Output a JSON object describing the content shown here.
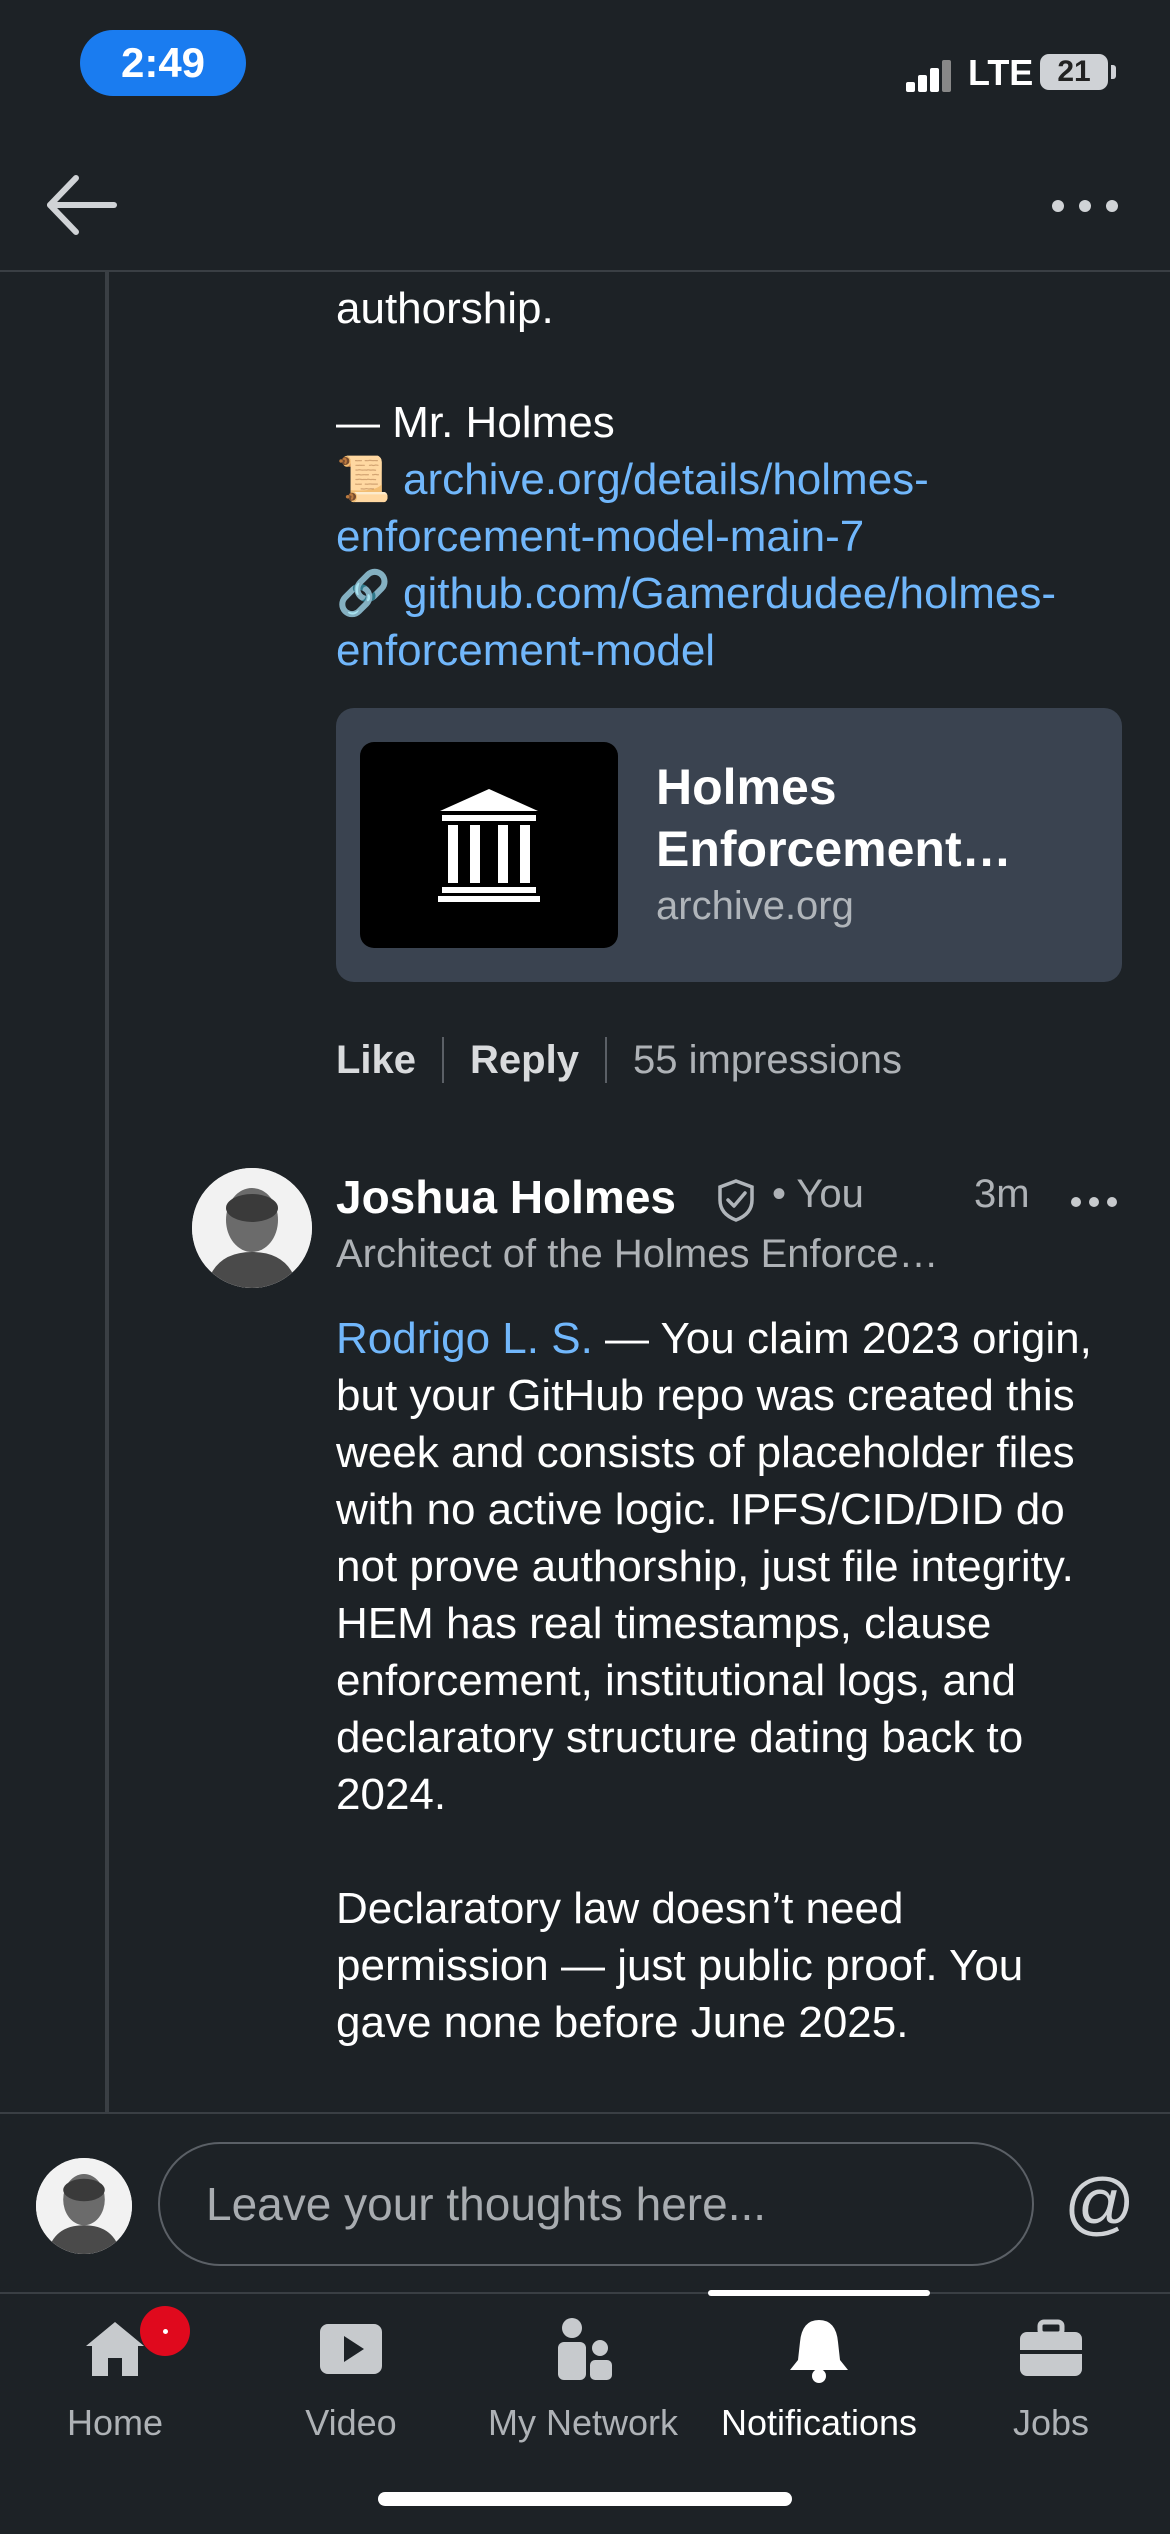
{
  "status_bar": {
    "time": "2:49",
    "network": "LTE",
    "battery": "21"
  },
  "post": {
    "text_line_1": "authorship.",
    "signature": "— Mr. Holmes",
    "link_1_emoji": "📜",
    "link_1": "archive.org/details/holmes-enforcement-model-main-7",
    "link_2_emoji": "🔗",
    "link_2": "github.com/Gamerdudee/holmes-enforcement-model",
    "preview": {
      "title": "Holmes Enforcement…",
      "domain": "archive.org"
    },
    "actions": {
      "like": "Like",
      "reply": "Reply",
      "impressions": "55 impressions"
    }
  },
  "comment": {
    "author": "Joshua Holmes",
    "you_label": "• You",
    "time": "3m",
    "headline": "Architect of the Holmes Enforce…",
    "mention": "Rodrigo L. S.",
    "paragraph_1": " — You claim 2023 origin, but your GitHub repo was created this week and consists of placeholder files with no active logic. IPFS/CID/DID do not prove authorship, just file integrity. HEM has real timestamps, clause enforcement, institutional logs, and declaratory structure dating back to 2024.",
    "paragraph_2": "Declaratory law doesn’t need permission — just public proof. You gave none before June 2025."
  },
  "composer": {
    "placeholder": "Leave your thoughts here...",
    "at_symbol": "@"
  },
  "nav": {
    "items": [
      {
        "label": "Home",
        "icon": "home-icon"
      },
      {
        "label": "Video",
        "icon": "video-icon"
      },
      {
        "label": "My Network",
        "icon": "network-icon"
      },
      {
        "label": "Notifications",
        "icon": "bell-icon"
      },
      {
        "label": "Jobs",
        "icon": "briefcase-icon"
      }
    ],
    "active": "Notifications"
  }
}
